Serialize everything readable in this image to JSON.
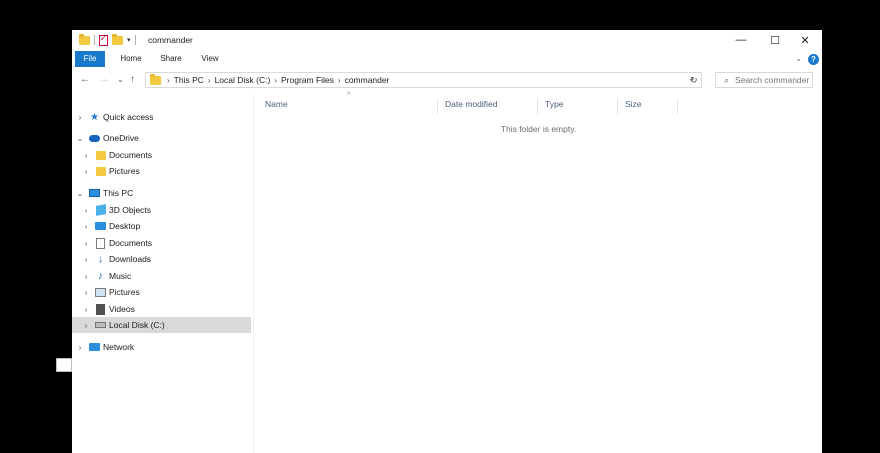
{
  "window": {
    "title": "commander",
    "controls": {
      "minimize": "—",
      "maximize": "☐",
      "close": "✕"
    }
  },
  "ribbon": {
    "tabs": [
      "File",
      "Home",
      "Share",
      "View"
    ],
    "help": "?",
    "expand": "⌄"
  },
  "nav": {
    "back": "←",
    "forward": "→",
    "recent": "⌄",
    "up": "↑"
  },
  "address": {
    "crumbs": [
      "This PC",
      "Local Disk (C:)",
      "Program Files",
      "commander"
    ],
    "separator": "›",
    "dropdown": "⌄",
    "refresh": "↻"
  },
  "search": {
    "placeholder": "Search commander",
    "icon": "⌕"
  },
  "tree": {
    "quick_access": "Quick access",
    "onedrive": "OneDrive",
    "onedrive_documents": "Documents",
    "onedrive_pictures": "Pictures",
    "this_pc": "This PC",
    "objects3d": "3D Objects",
    "desktop": "Desktop",
    "documents": "Documents",
    "downloads": "Downloads",
    "music": "Music",
    "pictures": "Pictures",
    "videos": "Videos",
    "local_disk": "Local Disk (C:)",
    "network": "Network",
    "chev_closed": "›",
    "chev_open": "⌄"
  },
  "columns": {
    "name": "Name",
    "date_modified": "Date modified",
    "type": "Type",
    "size": "Size",
    "sort_caret": "^"
  },
  "empty_message": "This folder is empty.",
  "colors": {
    "accent": "#1979ca",
    "selected_bg": "#d9d9d9",
    "header_text": "#4c607a"
  }
}
